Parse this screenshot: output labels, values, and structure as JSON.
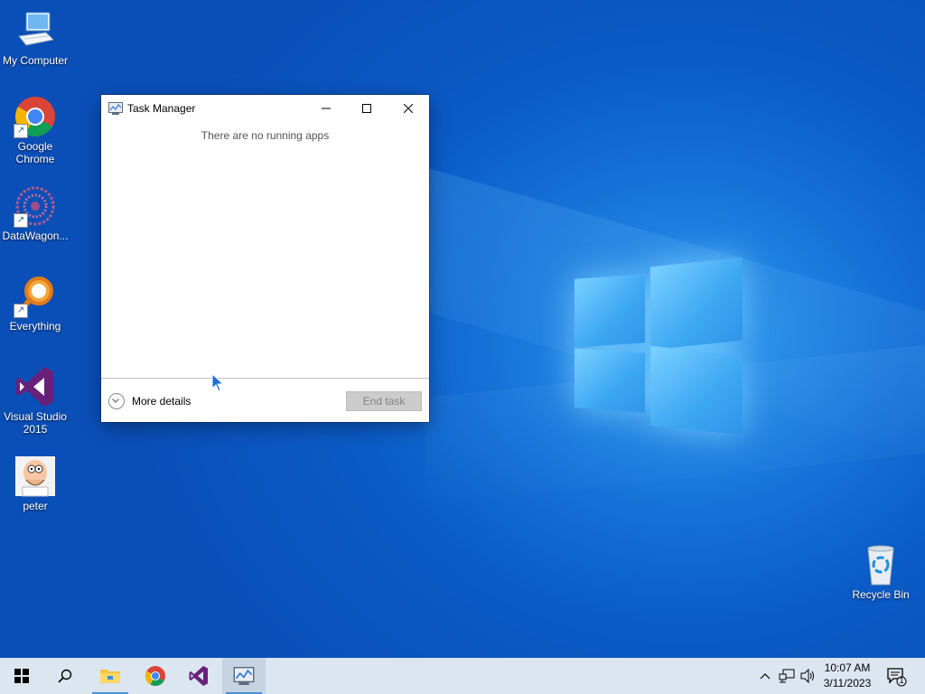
{
  "desktop": {
    "icons": [
      {
        "label": "My Computer"
      },
      {
        "label": "Google Chrome"
      },
      {
        "label": "DataWagon..."
      },
      {
        "label": "Everything"
      },
      {
        "label": "Visual Studio 2015"
      },
      {
        "label": "peter"
      },
      {
        "label": "Recycle Bin"
      }
    ]
  },
  "task_manager": {
    "title": "Task Manager",
    "empty_message": "There are no running apps",
    "more_details_label": "More details",
    "end_task_label": "End task"
  },
  "taskbar": {
    "clock": {
      "time": "10:07 AM",
      "date": "3/11/2023"
    },
    "notification_count": "1",
    "items": [
      "start-icon",
      "search-icon",
      "file-explorer-icon",
      "chrome-icon",
      "visual-studio-icon",
      "task-manager-icon"
    ]
  },
  "colors": {
    "desktop_blue": "#0b5bc6",
    "taskbar": "#dce6f0",
    "window_bg": "#ffffff",
    "button_disabled": "#cccccc"
  }
}
